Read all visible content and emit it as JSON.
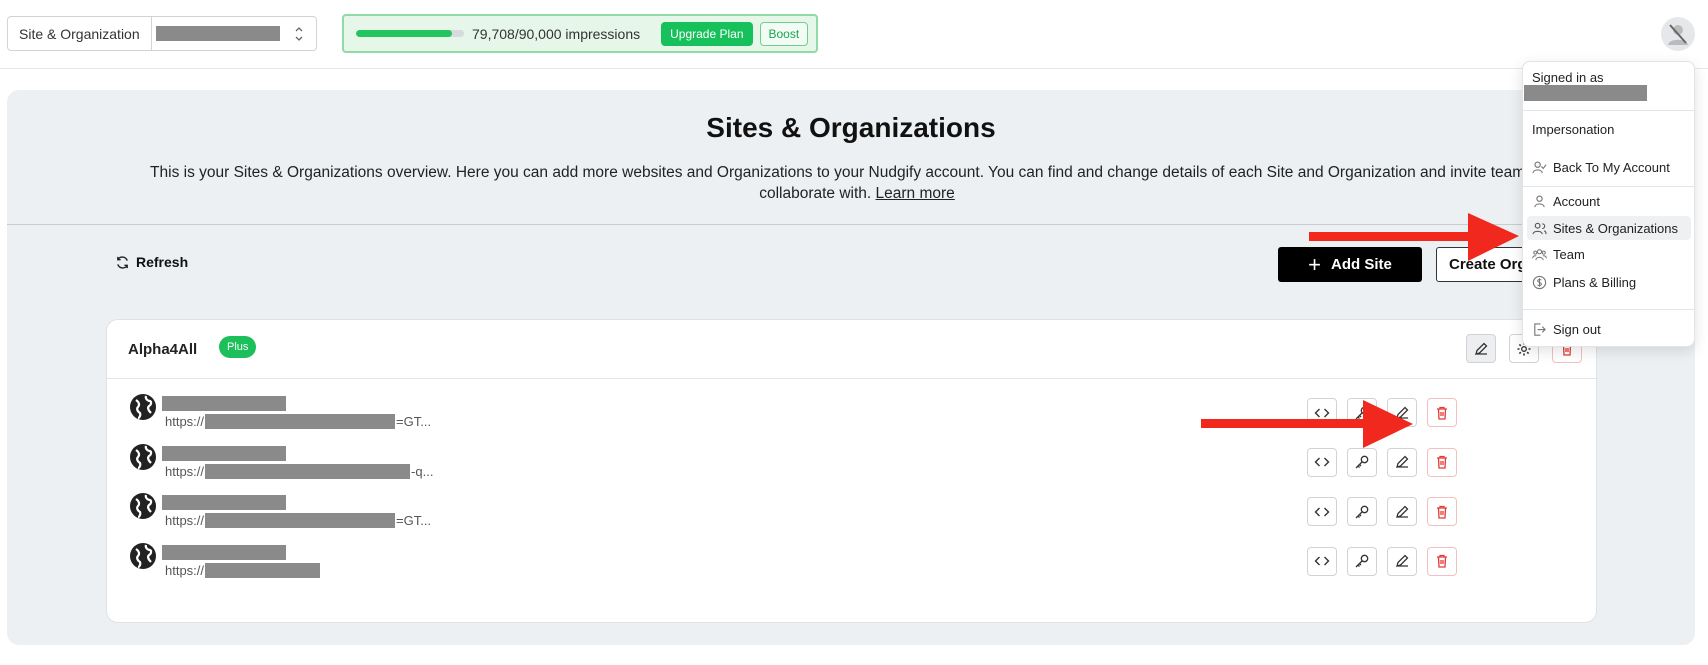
{
  "topbar": {
    "site_org_label": "Site & Organization",
    "usage": {
      "text": "79,708/90,000 impressions",
      "progress_fraction": 0.886
    },
    "upgrade_label": "Upgrade Plan",
    "boost_label": "Boost"
  },
  "main": {
    "title": "Sites & Organizations",
    "description": "This is your Sites & Organizations overview. Here you can add more websites and Organizations to your Nudgify account. You can find and change details of each Site and Organization and invite team mem",
    "description_line2": "collaborate with.",
    "learn_more": "Learn more",
    "refresh_label": "Refresh",
    "add_site_label": "Add Site",
    "create_org_label": "Create Org"
  },
  "org": {
    "name": "Alpha4All",
    "badge": "Plus",
    "sites": [
      {
        "url_prefix": "https://",
        "url_suffix": "=GT..."
      },
      {
        "url_prefix": "https://",
        "url_suffix": "-q..."
      },
      {
        "url_prefix": "https://",
        "url_suffix": "=GT..."
      },
      {
        "url_prefix": "https://",
        "url_suffix": ""
      }
    ]
  },
  "menu": {
    "signed_in_as": "Signed in as",
    "impersonation": "Impersonation",
    "back_to_account": "Back To My Account",
    "items": [
      {
        "label": "Account",
        "icon": "user-icon"
      },
      {
        "label": "Sites & Organizations",
        "icon": "users-icon"
      },
      {
        "label": "Team",
        "icon": "team-icon"
      },
      {
        "label": "Plans & Billing",
        "icon": "dollar-icon"
      }
    ],
    "sign_out": "Sign out"
  },
  "colors": {
    "accent_green": "#16c15b",
    "annotation_red": "#f0281e",
    "danger_red": "#e53935"
  }
}
